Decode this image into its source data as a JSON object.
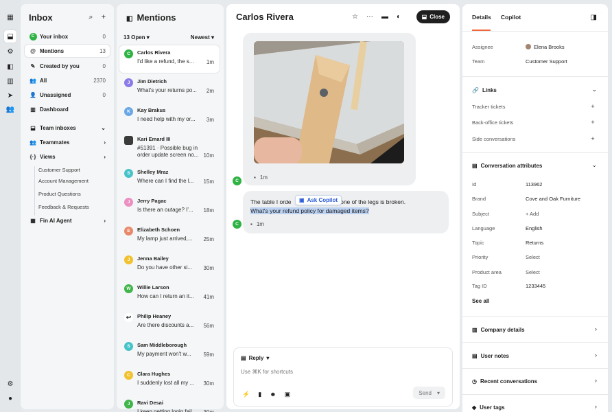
{
  "inbox": {
    "title": "Inbox",
    "nav": [
      {
        "label": "Your inbox",
        "count": "0"
      },
      {
        "label": "Mentions",
        "count": "13"
      },
      {
        "label": "Created by you",
        "count": "0"
      },
      {
        "label": "All",
        "count": "2370"
      },
      {
        "label": "Unassigned",
        "count": "0"
      },
      {
        "label": "Dashboard",
        "count": ""
      },
      {
        "label": "Team inboxes",
        "count": ""
      },
      {
        "label": "Teammates",
        "count": ""
      },
      {
        "label": "Views",
        "count": ""
      }
    ],
    "views": [
      "Customer Support",
      "Account Management",
      "Product Questions",
      "Feedback & Requests"
    ],
    "fin": "Fin AI Agent",
    "avatar_letter": "C"
  },
  "mentions": {
    "title": "Mentions",
    "filter": "13 Open",
    "sort": "Newest",
    "items": [
      {
        "initial": "C",
        "color": "#2fb344",
        "name": "Carlos Rivera",
        "preview": "I'd like a refund, the s...",
        "time": "1m"
      },
      {
        "initial": "J",
        "color": "#8b7be8",
        "name": "Jim Dietrich",
        "preview": "What's your returns po...",
        "time": "2m"
      },
      {
        "initial": "K",
        "color": "#6aa7e6",
        "name": "Kay Brakus",
        "preview": "I need help with my or...",
        "time": "3m"
      },
      {
        "initial": "",
        "color": "#3b3b3b",
        "name": "Kari Emard III",
        "preview": "#51391 · Possible bug in",
        "preview2": "order update screen no...",
        "time": "10m"
      },
      {
        "initial": "S",
        "color": "#46c3c8",
        "name": "Shelley Mraz",
        "preview": "Where can I find the l...",
        "time": "15m"
      },
      {
        "initial": "J",
        "color": "#ec8fc1",
        "name": "Jerry Pagac",
        "preview": "Is there an outage? I'...",
        "time": "18m"
      },
      {
        "initial": "E",
        "color": "#e8896b",
        "name": "Elizabeth Schoen",
        "preview": "My lamp just arrived,...",
        "time": "25m"
      },
      {
        "initial": "J",
        "color": "#f2c12e",
        "name": "Jenna Bailey",
        "preview": "Do you have other si...",
        "time": "30m"
      },
      {
        "initial": "W",
        "color": "#3fb54a",
        "name": "Willie Larson",
        "preview": "How can I return an it...",
        "time": "41m"
      },
      {
        "initial": "↩",
        "color": "#ffffff",
        "name": "Philip Heaney",
        "preview": "Are there discounts a...",
        "time": "56m"
      },
      {
        "initial": "S",
        "color": "#46c3c8",
        "name": "Sam Middleborough",
        "preview": "My payment won't w...",
        "time": "59m"
      },
      {
        "initial": "C",
        "color": "#f2c12e",
        "name": "Clara Hughes",
        "preview": "I suddenly lost all my ...",
        "time": "30m"
      },
      {
        "initial": "J",
        "color": "#3fb54a",
        "name": "Ravi Desai",
        "preview": "I keep getting login fail...",
        "time": "30m"
      }
    ]
  },
  "conversation": {
    "title": "Carlos Rivera",
    "close_label": "Close",
    "msg1_time": "1m",
    "msg2_line1a": "The table I orde",
    "msg2_line1b": "and one of the legs is broken.",
    "msg2_line2": "What's your refund policy for damaged items?",
    "msg2_time": "1m",
    "copilot_pill": "Ask Copilot",
    "avatar_letter": "C",
    "reply_label": "Reply",
    "shortcuts_placeholder": "Use ⌘K for shortcuts",
    "send_label": "Send"
  },
  "details": {
    "tabs": [
      "Details",
      "Copilot"
    ],
    "assignee_label": "Assignee",
    "assignee_value": "Elena Brooks",
    "team_label": "Team",
    "team_value": "Customer Support",
    "links_title": "Links",
    "links": [
      "Tracker tickets",
      "Back-office tickets",
      "Side conversations"
    ],
    "attrs_title": "Conversation attributes",
    "attrs": [
      {
        "label": "Id",
        "value": "113962"
      },
      {
        "label": "Brand",
        "value": "Cove and Oak Furniture"
      },
      {
        "label": "Subject",
        "value": "+ Add"
      },
      {
        "label": "Language",
        "value": "English"
      },
      {
        "label": "Topic",
        "value": "Returns"
      },
      {
        "label": "Priority",
        "value": "Select"
      },
      {
        "label": "Product area",
        "value": "Select"
      },
      {
        "label": "Tag ID",
        "value": "1233445"
      }
    ],
    "see_all": "See all",
    "sections": [
      "Company details",
      "User notes",
      "Recent conversations",
      "User tags"
    ]
  }
}
